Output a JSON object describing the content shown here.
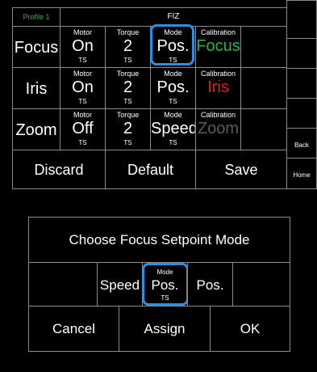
{
  "top": {
    "profile_label": "Profile 1",
    "title": "FIZ",
    "rows": [
      {
        "name": "Focus",
        "motor": {
          "label": "Motor",
          "value": "On",
          "sub": "TS"
        },
        "torque": {
          "label": "Torque",
          "value": "2",
          "sub": "TS"
        },
        "mode": {
          "label": "Mode",
          "value": "Pos.",
          "sub": "TS"
        },
        "calibration": {
          "label": "Calibration",
          "value": "Focus",
          "color": "#2bb24c"
        }
      },
      {
        "name": "Iris",
        "motor": {
          "label": "Motor",
          "value": "On",
          "sub": "TS"
        },
        "torque": {
          "label": "Torque",
          "value": "2",
          "sub": "TS"
        },
        "mode": {
          "label": "Mode",
          "value": "Pos.",
          "sub": "TS"
        },
        "calibration": {
          "label": "Calibration",
          "value": "Iris",
          "color": "#e01b1b"
        }
      },
      {
        "name": "Zoom",
        "motor": {
          "label": "Motor",
          "value": "Off",
          "sub": "TS"
        },
        "torque": {
          "label": "Torque",
          "value": "2",
          "sub": "TS"
        },
        "mode": {
          "label": "Mode",
          "value": "Speed",
          "sub": "TS"
        },
        "calibration": {
          "label": "Calibration",
          "value": "Zoom",
          "color": "#5a5a5a"
        }
      }
    ],
    "actions": {
      "discard": "Discard",
      "default": "Default",
      "save": "Save"
    },
    "side": {
      "back": "Back",
      "home": "Home"
    }
  },
  "dialog": {
    "title": "Choose Focus Setpoint Mode",
    "options": {
      "speed": "Speed",
      "selected_label": "Mode",
      "selected_value": "Pos.",
      "selected_sub": "TS",
      "pos": "Pos."
    },
    "buttons": {
      "cancel": "Cancel",
      "assign": "Assign",
      "ok": "OK"
    }
  },
  "colors": {
    "highlight": "#2d8fe0",
    "profile": "#2bb24c"
  }
}
